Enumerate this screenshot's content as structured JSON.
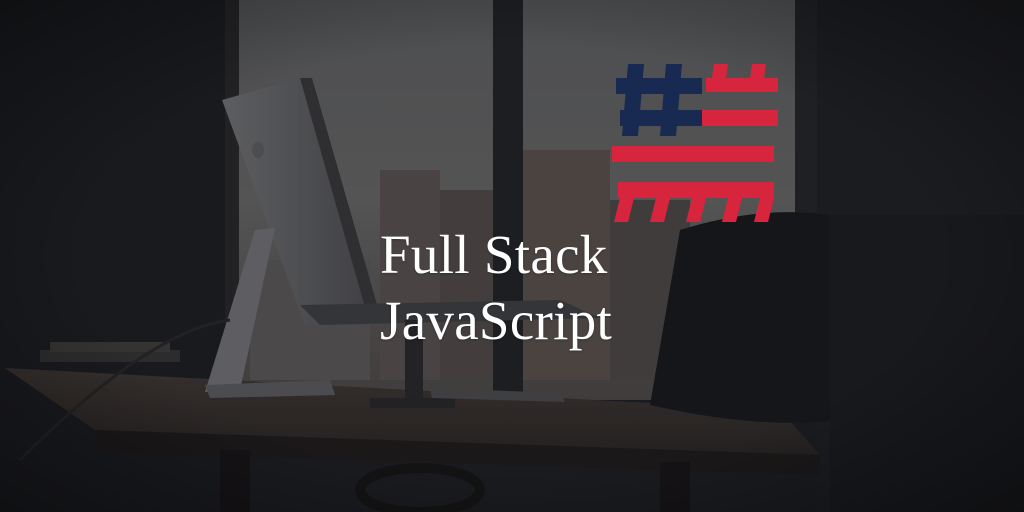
{
  "title": {
    "line1": "Full Stack",
    "line2": "JavaScript"
  },
  "logo": {
    "icon": "hashtag-flag-logo",
    "colors": {
      "navy": "#182a52",
      "red": "#d8253e"
    }
  },
  "background": {
    "description_icon": "desk-with-imac-photo",
    "colors": {
      "dark": "#1e2023",
      "window": "#7b7c7c",
      "desk": "#3a332d"
    }
  }
}
